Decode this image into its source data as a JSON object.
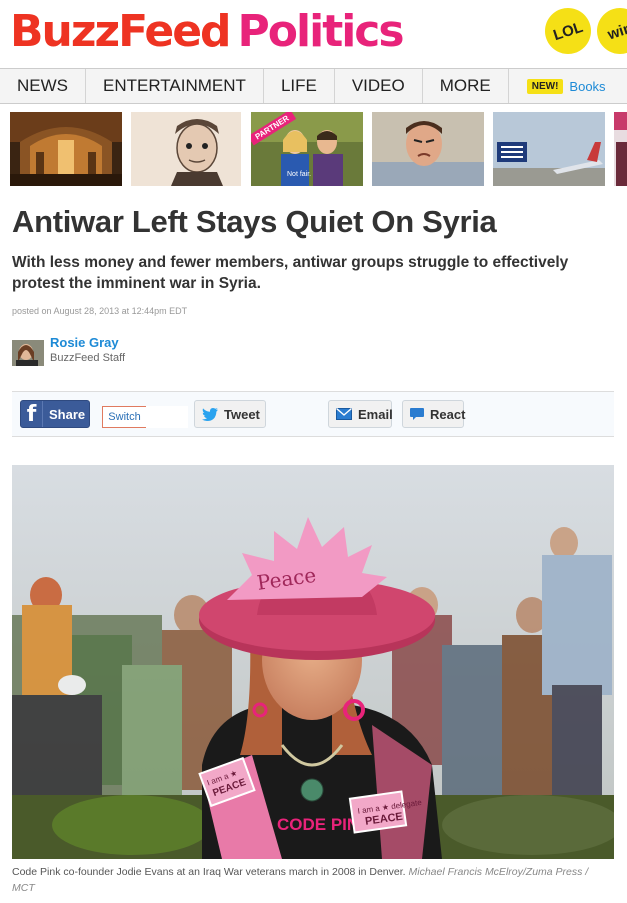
{
  "header": {
    "logo_buzzfeed": "BuzzFeed",
    "logo_section": "Politics",
    "badges": [
      "LOL",
      "win"
    ]
  },
  "nav": {
    "items": [
      "NEWS",
      "ENTERTAINMENT",
      "LIFE",
      "VIDEO",
      "MORE"
    ],
    "new_badge": "NEW!",
    "books_link": "Books"
  },
  "thumbs": {
    "partner_label": "PARTNER",
    "partner_caption": "Not fair."
  },
  "article": {
    "title": "Antiwar Left Stays Quiet On Syria",
    "subtitle": "With less money and fewer members, antiwar groups struggle to effectively protest the imminent war in Syria.",
    "posted": "posted on August 28, 2013 at 12:44pm EDT",
    "author_name": "Rosie Gray",
    "author_role": "BuzzFeed Staff"
  },
  "share": {
    "facebook": "Share",
    "switch": "Switch",
    "tweet": "Tweet",
    "email": "Email",
    "react": "React"
  },
  "photo": {
    "hat_text": "Peace",
    "pin_text": "I am a ★ delegate PEACE",
    "shirt_text": "CODE PINK"
  },
  "caption": {
    "text": "Code Pink co-founder Jodie Evans at an Iraq War veterans march in 2008 in Denver.",
    "credit": "Michael Francis McElroy/Zuma Press / MCT"
  },
  "colors": {
    "buzzfeed_red": "#ee3322",
    "politics_pink": "#e8237a",
    "link_blue": "#1d8ad6",
    "badge_yellow": "#f5e016",
    "facebook_blue": "#3b5b99"
  }
}
